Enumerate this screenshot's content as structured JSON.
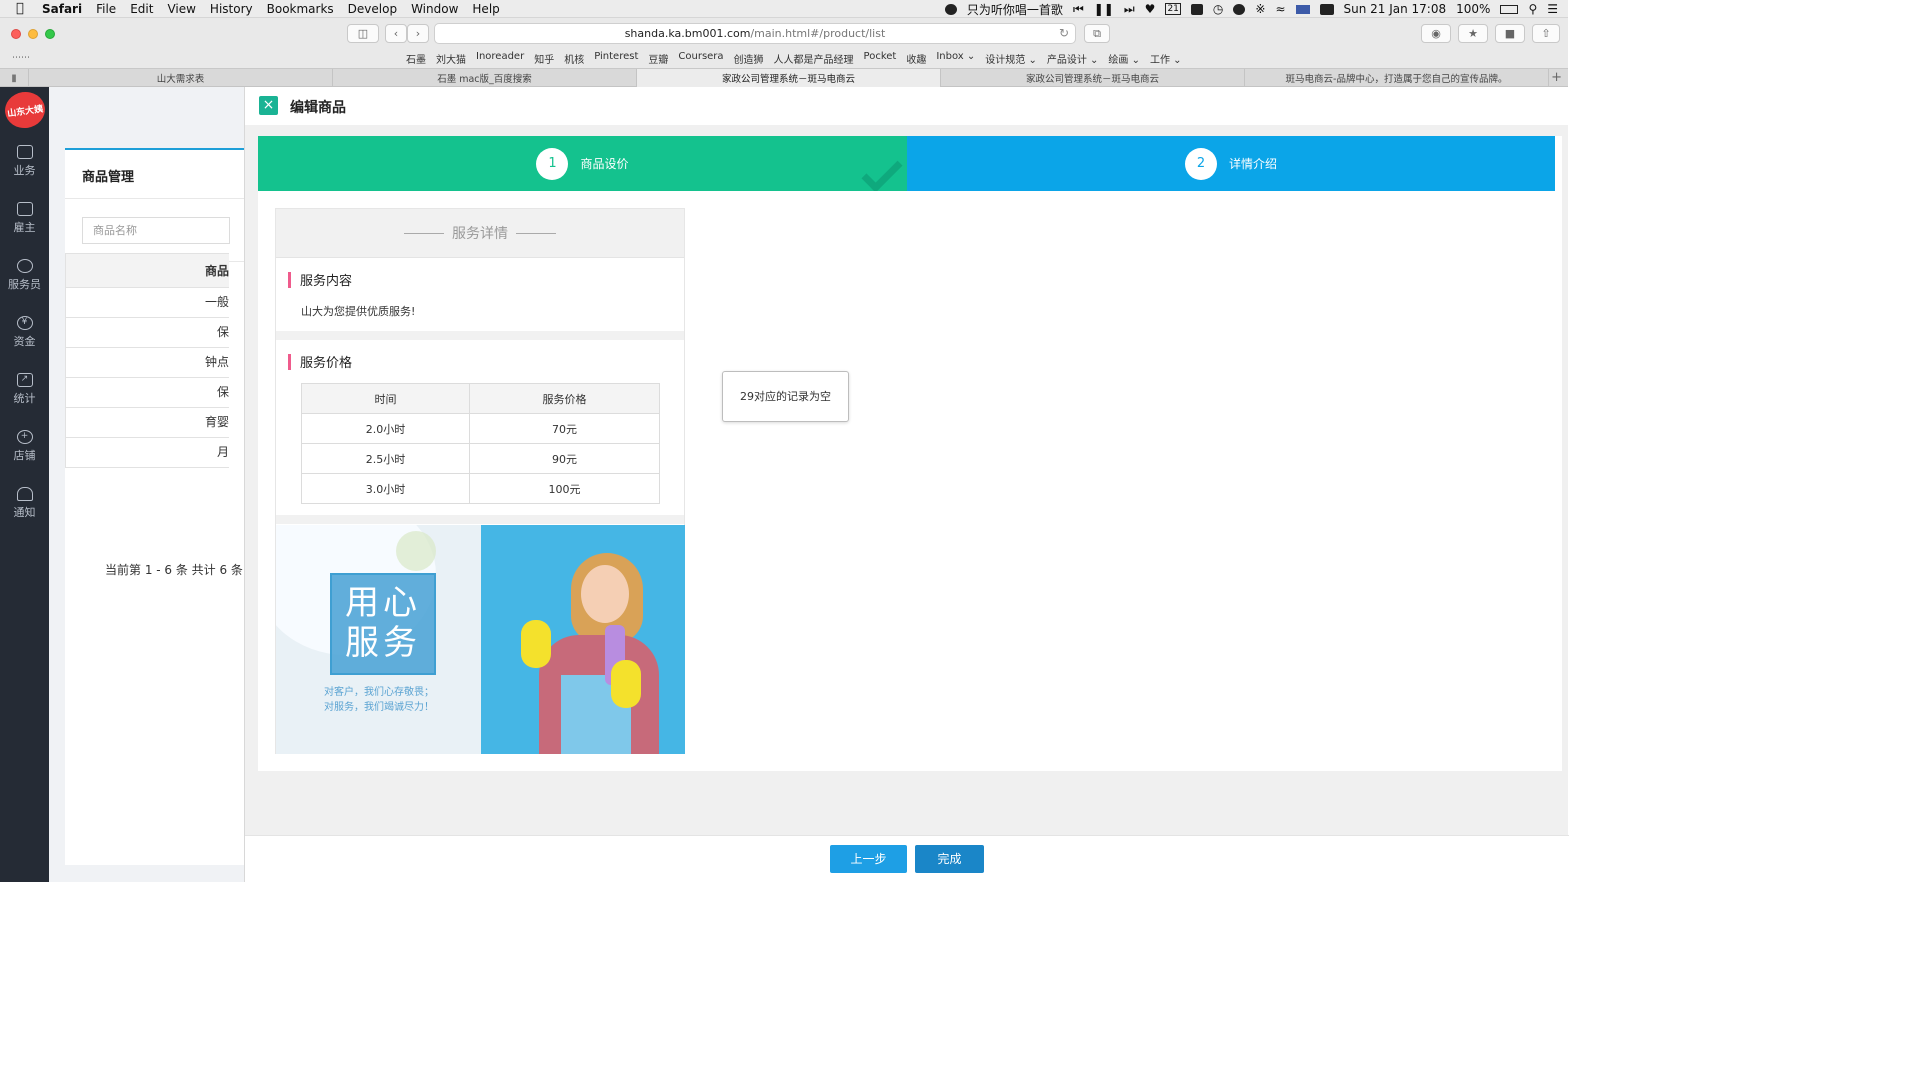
{
  "menubar": {
    "apple": "",
    "items": [
      "Safari",
      "File",
      "Edit",
      "View",
      "History",
      "Bookmarks",
      "Develop",
      "Window",
      "Help"
    ],
    "now_playing": "只为听你唱一首歌",
    "calendar_day": "21",
    "battery": "100%",
    "datetime": "Sun 21 Jan  17:08"
  },
  "browser": {
    "url_domain": "shanda.ka.bm001.com",
    "url_path": "/main.html#/product/list",
    "bookmarks": [
      "石墨",
      "刘大猫",
      "Inoreader",
      "知乎",
      "机核",
      "Pinterest",
      "豆瓣",
      "Coursera",
      "创造狮",
      "人人都是产品经理",
      "Pocket",
      "收趣",
      "Inbox ⌄",
      "设计规范 ⌄",
      "产品设计 ⌄",
      "绘画 ⌄",
      "工作 ⌄"
    ],
    "tabs": [
      {
        "label": "山大需求表",
        "active": false
      },
      {
        "label": "石墨 mac版_百度搜索",
        "active": false
      },
      {
        "label": "家政公司管理系统－斑马电商云",
        "active": true
      },
      {
        "label": "家政公司管理系统－斑马电商云",
        "active": false
      },
      {
        "label": "斑马电商云-品牌中心，打造属于您自己的宣传品牌。",
        "active": false
      }
    ]
  },
  "sidebar": {
    "logo": "山东大姨",
    "items": [
      {
        "label": "业务",
        "icon": "briefcase-icon"
      },
      {
        "label": "雇主",
        "icon": "employer-icon"
      },
      {
        "label": "服务员",
        "icon": "staff-icon"
      },
      {
        "label": "资金",
        "icon": "yen-icon"
      },
      {
        "label": "统计",
        "icon": "chart-icon"
      },
      {
        "label": "店铺",
        "icon": "globe-icon"
      },
      {
        "label": "通知",
        "icon": "bell-icon"
      }
    ]
  },
  "background_page": {
    "title": "商品管理",
    "search_placeholder": "商品名称",
    "table_header": "商品",
    "rows": [
      "一般",
      "保",
      "钟点",
      "保",
      "育婴",
      "月"
    ],
    "pager": "当前第 1 - 6 条 共计 6 条"
  },
  "modal": {
    "title": "编辑商品",
    "close_icon": "×",
    "steps": [
      {
        "num": "1",
        "label": "商品设价",
        "color": "#14c28e"
      },
      {
        "num": "2",
        "label": "详情介绍",
        "color": "#0ba5e8"
      }
    ],
    "detail": {
      "header": "服务详情",
      "content_title": "服务内容",
      "content_text": "山大为您提供优质服务!",
      "price_title": "服务价格",
      "price_columns": [
        "时间",
        "服务价格"
      ],
      "price_rows": [
        [
          "2.0小时",
          "70元"
        ],
        [
          "2.5小时",
          "90元"
        ],
        [
          "3.0小时",
          "100元"
        ]
      ],
      "banner": {
        "big_text_line1": "用心",
        "big_text_line2": "服务",
        "sub_line1": "对客户，我们心存敬畏；",
        "sub_line2": "对服务，我们竭诚尽力！"
      }
    },
    "empty_tip": "29对应的记录为空",
    "buttons": {
      "prev": "上一步",
      "done": "完成"
    }
  }
}
